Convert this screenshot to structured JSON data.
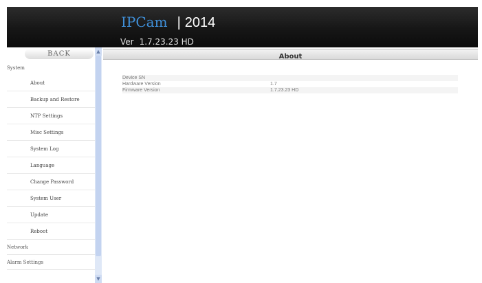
{
  "header": {
    "brand": "IPCam",
    "separator": "|",
    "year": "2014",
    "version_prefix": "Ver",
    "version": "1.7.23.23 HD"
  },
  "nav": {
    "back_label": "BACK",
    "section_system": "System",
    "items": [
      {
        "label": "About"
      },
      {
        "label": "Backup and Restore"
      },
      {
        "label": "NTP Settings"
      },
      {
        "label": "Misc Settings"
      },
      {
        "label": "System Log"
      },
      {
        "label": "Language"
      },
      {
        "label": "Change Password"
      },
      {
        "label": "System User"
      },
      {
        "label": "Update"
      },
      {
        "label": "Reboot"
      }
    ],
    "section_network": "Network",
    "section_alarm": "Alarm Settings"
  },
  "main": {
    "title": "About",
    "rows": [
      {
        "label": "Device SN",
        "value": ""
      },
      {
        "label": "Hardware Version",
        "value": "1.7"
      },
      {
        "label": "Firmware Version",
        "value": "1.7.23.23 HD"
      }
    ]
  },
  "colors": {
    "brand": "#3f8fd8",
    "header_bg": "#161616",
    "scrollbar": "#dfe8f7"
  }
}
